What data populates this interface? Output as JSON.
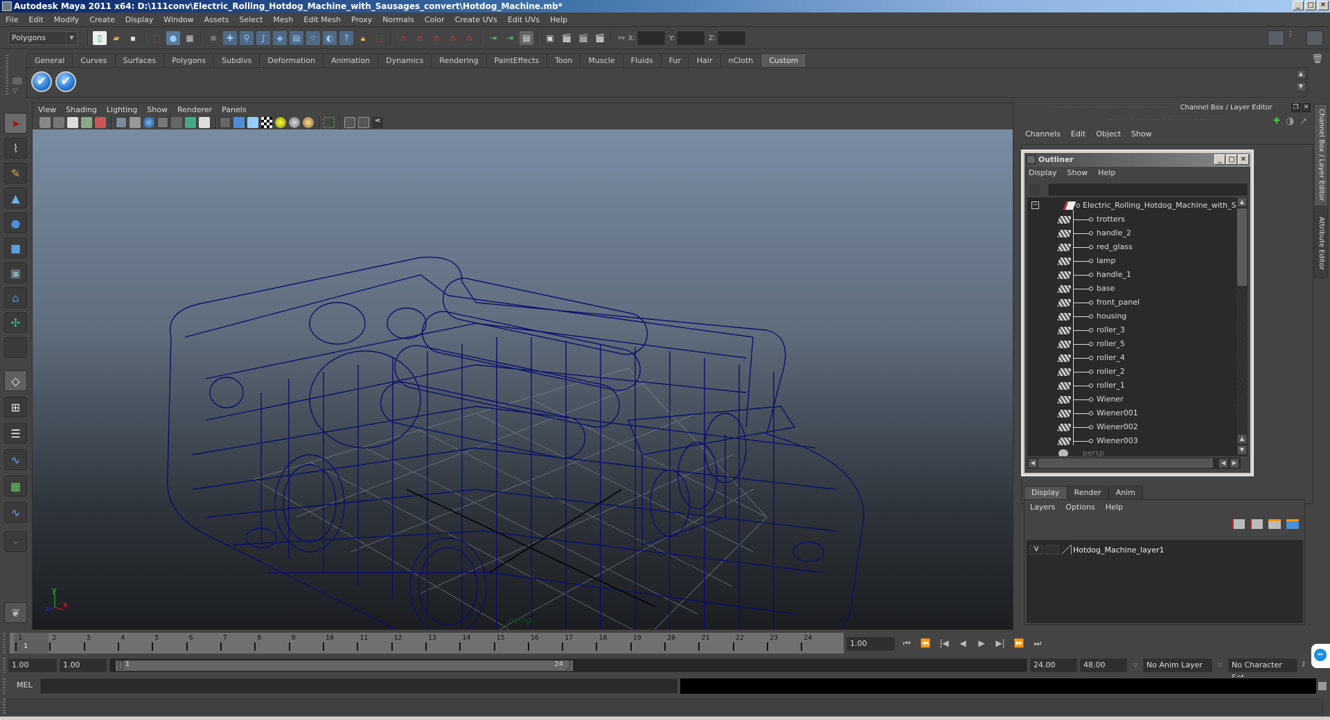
{
  "window": {
    "title": "Autodesk Maya 2011 x64: D:\\111conv\\Electric_Rolling_Hotdog_Machine_with_Sausages_convert\\Hotdog_Machine.mb*",
    "buttons": {
      "minimize": "_",
      "maximize": "□",
      "close": "✕"
    }
  },
  "menubar": [
    "File",
    "Edit",
    "Modify",
    "Create",
    "Display",
    "Window",
    "Assets",
    "Select",
    "Mesh",
    "Edit Mesh",
    "Proxy",
    "Normals",
    "Color",
    "Create UVs",
    "Edit UVs",
    "Help"
  ],
  "statusline": {
    "mode": "Polygons",
    "x_label": "X:",
    "y_label": "Y:",
    "z_label": "Z:",
    "x_value": "",
    "y_value": "",
    "z_value": ""
  },
  "shelf": {
    "tabs": [
      "General",
      "Curves",
      "Surfaces",
      "Polygons",
      "Subdivs",
      "Deformation",
      "Animation",
      "Dynamics",
      "Rendering",
      "PaintEffects",
      "Toon",
      "Muscle",
      "Fluids",
      "Fur",
      "Hair",
      "nCloth",
      "Custom"
    ],
    "active_tab": "Custom",
    "icons": [
      "checkmark-script-icon",
      "checkmark-script-icon"
    ],
    "icon_glyph": "✔"
  },
  "toolbox": {
    "tools": [
      {
        "name": "select-tool",
        "glyph": "➤",
        "selected": true
      },
      {
        "name": "lasso-tool",
        "glyph": "⌇"
      },
      {
        "name": "paint-select-tool",
        "glyph": "✎"
      },
      {
        "name": "move-tool",
        "glyph": "▲"
      },
      {
        "name": "rotate-tool",
        "glyph": "●"
      },
      {
        "name": "scale-tool",
        "glyph": "■"
      },
      {
        "name": "universal-manipulator",
        "glyph": "▣"
      },
      {
        "name": "soft-modification-tool",
        "glyph": "⌂"
      },
      {
        "name": "show-manipulator-tool",
        "glyph": "✣"
      },
      {
        "name": "last-tool",
        "glyph": ""
      }
    ],
    "layouts": [
      "single-perspective-layout",
      "four-view-layout",
      "outliner-persp-layout",
      "persp-graph-layout",
      "hypershade-persp-layout",
      "persp-graph-hypergraph-layout"
    ],
    "more": "⌄"
  },
  "viewport": {
    "menu": [
      "View",
      "Shading",
      "Lighting",
      "Show",
      "Renderer",
      "Panels"
    ],
    "camera_label": "persp",
    "axis": {
      "x": "x",
      "y": "y",
      "z": "z"
    },
    "wireframe_color": "#0b0e6e",
    "background_top": "#7a8ca3",
    "background_bottom": "#1b1d20"
  },
  "channelbox": {
    "title": "Channel Box / Layer Editor",
    "menu": [
      "Channels",
      "Edit",
      "Object",
      "Show"
    ]
  },
  "outliner": {
    "title": "Outliner",
    "menu": [
      "Display",
      "Show",
      "Help"
    ],
    "filter_value": "",
    "root": "Electric_Rolling_Hotdog_Machine_with_Sausages",
    "children": [
      "trotters",
      "handle_2",
      "red_glass",
      "lamp",
      "handle_1",
      "base",
      "front_panel",
      "housing",
      "roller_3",
      "roller_5",
      "roller_4",
      "roller_2",
      "roller_1",
      "Wiener",
      "Wiener001",
      "Wiener002",
      "Wiener003"
    ],
    "partial_item": "persp"
  },
  "layer_editor": {
    "tabs": [
      "Display",
      "Render",
      "Anim"
    ],
    "active_tab": "Display",
    "menu": [
      "Layers",
      "Options",
      "Help"
    ],
    "layers": [
      {
        "visible": "V",
        "name": "Hotdog_Machine_layer1"
      }
    ]
  },
  "side_tabs": [
    "Channel Box / Layer Editor",
    "Attribute Editor"
  ],
  "timeslider": {
    "ticks": [
      "1",
      "2",
      "3",
      "4",
      "5",
      "6",
      "7",
      "8",
      "9",
      "10",
      "11",
      "12",
      "13",
      "14",
      "15",
      "16",
      "17",
      "18",
      "19",
      "20",
      "21",
      "22",
      "23",
      "24"
    ],
    "current_frame_marker": "1",
    "current_time": "1.00",
    "playback_buttons": [
      "⏮",
      "⏪",
      "|◀",
      "◀",
      "▶",
      "▶|",
      "⏩",
      "⏭"
    ]
  },
  "rangeslider": {
    "start_time": "1.00",
    "playback_start": "1.00",
    "range_start_label": "1",
    "range_end_label": "24",
    "playback_end": "24.00",
    "end_time": "48.00",
    "anim_layer": "No Anim Layer",
    "character_set": "No Character Set"
  },
  "commandline": {
    "label": "MEL",
    "input": "",
    "output": ""
  },
  "helpline": {
    "text": ""
  }
}
